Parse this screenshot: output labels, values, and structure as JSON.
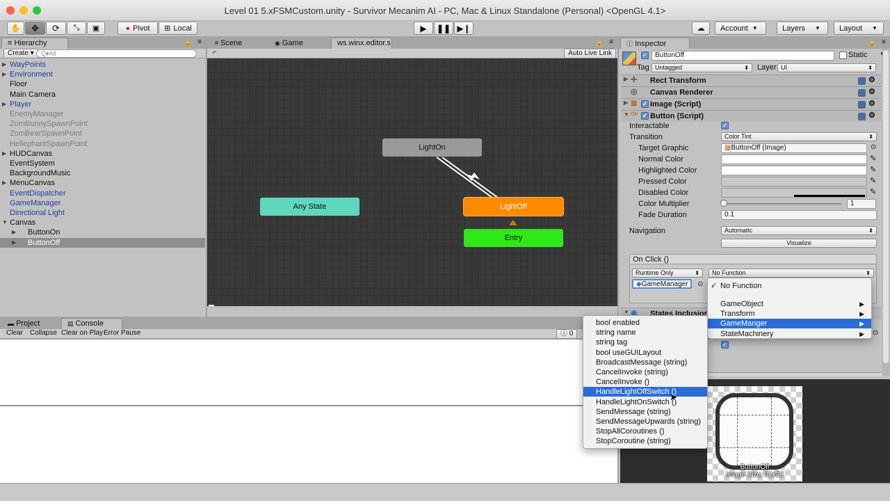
{
  "window": {
    "title": "Level 01 5.xFSMCustom.unity - Survivor Mecanim AI - PC, Mac & Linux Standalone (Personal) <OpenGL 4.1>"
  },
  "toolbar": {
    "pivot": "Pivot",
    "local": "Local",
    "account": "Account",
    "layers": "Layers",
    "layout": "Layout"
  },
  "hierarchy": {
    "tab": "Hierarchy",
    "create": "Create",
    "search_placeholder": "Q▾All",
    "items": [
      {
        "label": "WayPoints",
        "style": "blue",
        "arrow": true
      },
      {
        "label": "Environment",
        "style": "blue",
        "arrow": true
      },
      {
        "label": "Floor",
        "style": "normal",
        "arrow": false
      },
      {
        "label": "Main Camera",
        "style": "normal",
        "arrow": false
      },
      {
        "label": "Player",
        "style": "blue",
        "arrow": true
      },
      {
        "label": "EnemyManager",
        "style": "gray",
        "arrow": false
      },
      {
        "label": "ZomBunnySpawnPoint",
        "style": "gray",
        "arrow": false
      },
      {
        "label": "ZomBearSpawnPoint",
        "style": "gray",
        "arrow": false
      },
      {
        "label": "HellephantSpawnPoint",
        "style": "gray",
        "arrow": false
      },
      {
        "label": "HUDCanvas",
        "style": "normal",
        "arrow": true
      },
      {
        "label": "EventSystem",
        "style": "normal",
        "arrow": false
      },
      {
        "label": "BackgroundMusic",
        "style": "normal",
        "arrow": false
      },
      {
        "label": "MenuCanvas",
        "style": "normal",
        "arrow": true
      },
      {
        "label": "EventDispatcher",
        "style": "blue",
        "arrow": false
      },
      {
        "label": "GameManager",
        "style": "blue",
        "arrow": false
      },
      {
        "label": "Directional Light",
        "style": "blue",
        "arrow": false
      },
      {
        "label": "Canvas",
        "style": "normal",
        "arrow": true
      },
      {
        "label": "ButtonOn",
        "style": "normal",
        "arrow": true
      },
      {
        "label": "ButtonOff",
        "style": "selected",
        "arrow": true
      }
    ]
  },
  "center_tabs": {
    "scene": "Scene",
    "game": "Game",
    "editor": "ws.winx.editor.s"
  },
  "animator": {
    "auto_live_link": "Auto Live Link",
    "states": {
      "light_on": "LightOn",
      "any_state": "Any State",
      "light_off": "LightOff",
      "entry": "Entry"
    },
    "colors": {
      "light_on": "#9a9a9a",
      "any_state": "#5fd6be",
      "light_off": "#ff8a00",
      "entry": "#2ee81a"
    }
  },
  "console": {
    "project_tab": "Project",
    "console_tab": "Console",
    "buttons": {
      "clear": "Clear",
      "collapse": "Collapse",
      "clear_on_play": "Clear on Play",
      "error_pause": "Error Pause"
    },
    "count": "0"
  },
  "inspector": {
    "tab": "Inspector",
    "name": "ButtonOff",
    "static_label": "Static",
    "tag_label": "Tag",
    "tag_value": "Untagged",
    "layer_label": "Layer",
    "layer_value": "UI",
    "components": {
      "rect_transform": "Rect Transform",
      "canvas_renderer": "Canvas Renderer",
      "image_script": "Image (Script)",
      "button_script": "Button (Script)",
      "states_inclusion": "States Inclusion"
    },
    "button": {
      "interactable": "Interactable",
      "transition": "Transition",
      "transition_value": "Color Tint",
      "target_graphic": "Target Graphic",
      "target_graphic_value": "ButtonOff (Image)",
      "normal_color": "Normal Color",
      "highlighted_color": "Highlighted Color",
      "pressed_color": "Pressed Color",
      "disabled_color": "Disabled Color",
      "color_multiplier": "Color Multiplier",
      "color_multiplier_value": "1",
      "fade_duration": "Fade Duration",
      "fade_duration_value": "0.1",
      "navigation": "Navigation",
      "navigation_value": "Automatic",
      "visualize": "Visualize"
    },
    "on_click": {
      "header": "On Click ()",
      "runtime": "Runtime Only",
      "function": "No Function",
      "object": "GameManager"
    },
    "preview": {
      "name": "ButtonOff",
      "size": "Image Size: 32x32"
    }
  },
  "function_menu": {
    "no_function": "No Function",
    "items": [
      {
        "label": "GameObject",
        "selected": false
      },
      {
        "label": "Transform",
        "selected": false
      },
      {
        "label": "GameManger",
        "selected": true
      },
      {
        "label": "StateMachinery",
        "selected": false
      }
    ]
  },
  "method_menu": {
    "items": [
      {
        "label": "bool enabled",
        "selected": false
      },
      {
        "label": "string name",
        "selected": false
      },
      {
        "label": "string tag",
        "selected": false
      },
      {
        "label": "bool useGUILayout",
        "selected": false
      },
      {
        "label": "BroadcastMessage (string)",
        "selected": false
      },
      {
        "label": "CancelInvoke (string)",
        "selected": false
      },
      {
        "label": "CancelInvoke ()",
        "selected": false
      },
      {
        "label": "HandleLightOffSwitch ()",
        "selected": true
      },
      {
        "label": "HandleLightOnSwitch ()",
        "selected": false
      },
      {
        "label": "SendMessage (string)",
        "selected": false
      },
      {
        "label": "SendMessageUpwards (string)",
        "selected": false
      },
      {
        "label": "StopAllCoroutines ()",
        "selected": false
      },
      {
        "label": "StopCoroutine (string)",
        "selected": false
      }
    ]
  }
}
